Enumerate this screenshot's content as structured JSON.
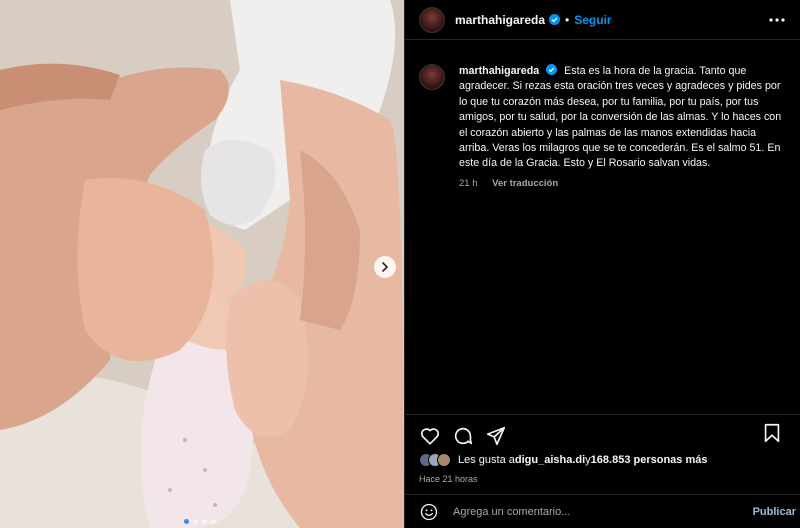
{
  "post": {
    "author": "marthahigareda",
    "follow_label": "Seguir",
    "separator": "•",
    "more_icon": "more-horizontal-icon"
  },
  "caption": {
    "username": "marthahigareda",
    "text": "Esta es la hora de la gracia. Tanto que agradecer. Si rezas esta oración tres veces y agradeces y pides por lo que tu corazón más desea, por tu familia, por tu país, por tus amigos, por tu salud, por la conversión de las almas. Y lo haces con el corazón abierto y las palmas de las manos extendidas hacia arriba. Veras los milagros que se te concederán. Es el salmo 51. En este día de la Gracia. Esto y El Rosario salvan vidas.",
    "time": "21 h",
    "translate_label": "Ver traducción"
  },
  "actions": {
    "like_icon": "heart-icon",
    "comment_icon": "comment-icon",
    "share_icon": "share-icon",
    "save_icon": "bookmark-icon"
  },
  "likes": {
    "prefix": "Les gusta a ",
    "user": "digu_aisha.di",
    "middle": " y ",
    "count": "168.853 personas más"
  },
  "timestamp": "Hace 21 horas",
  "comment": {
    "placeholder": "Agrega un comentario...",
    "publish_label": "Publicar"
  },
  "carousel": {
    "total": 4,
    "active_index": 0
  },
  "colors": {
    "accent": "#0095f6",
    "verified": "#0095f6",
    "active_dot": "#2f8ff0"
  }
}
